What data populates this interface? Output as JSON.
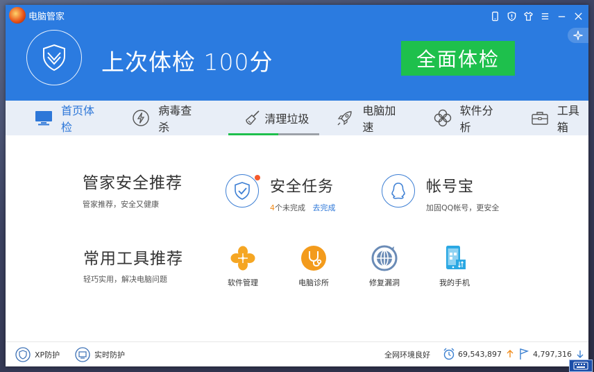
{
  "window": {
    "title": "电脑管家"
  },
  "header": {
    "score_text": "上次体检 100分",
    "exam_button": "全面体检"
  },
  "tabs": [
    {
      "label": "首页体检",
      "icon": "monitor-icon",
      "active": true
    },
    {
      "label": "病毒查杀",
      "icon": "lightning-icon",
      "active": false
    },
    {
      "label": "清理垃圾",
      "icon": "broom-icon",
      "active": false
    },
    {
      "label": "电脑加速",
      "icon": "rocket-icon",
      "active": false
    },
    {
      "label": "软件分析",
      "icon": "clover-icon",
      "active": false
    },
    {
      "label": "工具箱",
      "icon": "toolbox-icon",
      "active": false
    }
  ],
  "tab_progress": {
    "tab": "清理垃圾",
    "fraction": 0.55
  },
  "recommend": {
    "title": "管家安全推荐",
    "subtitle": "管家推荐，安全又健康"
  },
  "security_task": {
    "title": "安全任务",
    "count": "4",
    "pending_text": "个未完成",
    "link": "去完成"
  },
  "account": {
    "title": "帐号宝",
    "subtitle": "加固QQ帐号，更安全"
  },
  "tools_section": {
    "title": "常用工具推荐",
    "subtitle": "轻巧实用，解决电脑问题"
  },
  "tools": [
    {
      "label": "软件管理",
      "icon": "clover-orange-icon"
    },
    {
      "label": "电脑诊所",
      "icon": "stethoscope-icon"
    },
    {
      "label": "修复漏洞",
      "icon": "patch-globe-icon"
    },
    {
      "label": "我的手机",
      "icon": "phone-icon"
    }
  ],
  "footer": {
    "xp_protect": "XP防护",
    "realtime_protect": "实时防护",
    "net_status": "全网环境良好",
    "stat1": "69,543,897",
    "stat2": "4,797,316"
  },
  "colors": {
    "header_blue": "#2b7be0",
    "accent_green": "#1ec04c",
    "link_blue": "#2d77d8",
    "orange": "#f18b1a"
  }
}
